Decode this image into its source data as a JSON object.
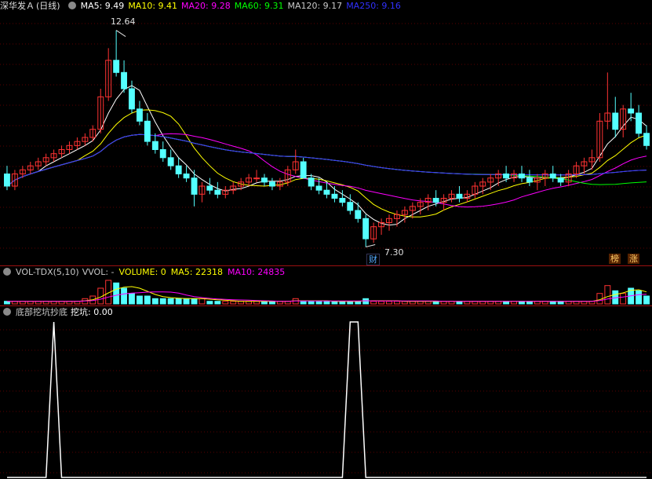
{
  "main": {
    "stock_name": "深华发Ａ",
    "period": "(日线)",
    "ma": [
      {
        "label": "MA5:",
        "value": "9.49",
        "color": "#ffffff"
      },
      {
        "label": "MA10:",
        "value": "9.41",
        "color": "#ffff00"
      },
      {
        "label": "MA20:",
        "value": "9.28",
        "color": "#ff00ff"
      },
      {
        "label": "MA60:",
        "value": "9.31",
        "color": "#00ff00"
      },
      {
        "label": "MA120:",
        "value": "9.17",
        "color": "#c8c8c8"
      },
      {
        "label": "MA250:",
        "value": "9.16",
        "color": "#3030ff"
      }
    ],
    "high_label": "12.64",
    "low_label": "7.30",
    "badge_cai": "财",
    "badge_bang": "榜",
    "badge_zhang": "涨"
  },
  "volume": {
    "name": "VOL-TDX(5,10)",
    "vvol": "VVOL: -",
    "volume": "VOLUME: 0",
    "ma5": "MA5: 22318",
    "ma10": "MA10: 24835"
  },
  "indicator": {
    "name": "底部挖坑抄底",
    "series_label": "挖坑: 0.00"
  },
  "colors": {
    "up": "#ff3232",
    "down": "#54ffff",
    "bg": "#000000",
    "separator": "#9a1010"
  },
  "chart_data": [
    {
      "type": "candlestick",
      "title": "深华发Ａ (日线)",
      "ylim": [
        7.0,
        13.0
      ],
      "annotations": [
        {
          "label": "12.64",
          "kind": "high"
        },
        {
          "label": "7.30",
          "kind": "low"
        }
      ],
      "ohlc": [
        [
          9.1,
          9.3,
          8.7,
          8.8
        ],
        [
          8.8,
          9.2,
          8.7,
          9.1
        ],
        [
          9.1,
          9.3,
          9.0,
          9.2
        ],
        [
          9.2,
          9.4,
          9.1,
          9.3
        ],
        [
          9.3,
          9.5,
          9.2,
          9.4
        ],
        [
          9.4,
          9.6,
          9.3,
          9.5
        ],
        [
          9.5,
          9.7,
          9.4,
          9.6
        ],
        [
          9.6,
          9.8,
          9.5,
          9.7
        ],
        [
          9.7,
          9.9,
          9.6,
          9.8
        ],
        [
          9.8,
          10.0,
          9.7,
          9.9
        ],
        [
          9.9,
          10.1,
          9.8,
          10.0
        ],
        [
          10.0,
          10.3,
          9.9,
          10.2
        ],
        [
          10.2,
          11.2,
          10.1,
          11.0
        ],
        [
          11.0,
          12.2,
          10.9,
          11.9
        ],
        [
          11.9,
          12.64,
          11.5,
          11.6
        ],
        [
          11.6,
          11.9,
          11.1,
          11.2
        ],
        [
          11.2,
          11.4,
          10.6,
          10.7
        ],
        [
          10.7,
          10.9,
          10.3,
          10.4
        ],
        [
          10.4,
          10.6,
          9.8,
          9.9
        ],
        [
          9.9,
          10.1,
          9.6,
          9.7
        ],
        [
          9.7,
          9.9,
          9.4,
          9.5
        ],
        [
          9.5,
          9.7,
          9.2,
          9.3
        ],
        [
          9.3,
          9.5,
          9.0,
          9.1
        ],
        [
          9.1,
          9.3,
          8.9,
          9.0
        ],
        [
          9.0,
          9.2,
          8.3,
          8.6
        ],
        [
          8.6,
          8.9,
          8.4,
          8.8
        ],
        [
          8.8,
          9.0,
          8.6,
          8.7
        ],
        [
          8.7,
          8.9,
          8.5,
          8.6
        ],
        [
          8.6,
          8.8,
          8.5,
          8.7
        ],
        [
          8.7,
          8.9,
          8.6,
          8.8
        ],
        [
          8.8,
          9.0,
          8.7,
          8.9
        ],
        [
          8.9,
          9.1,
          8.8,
          9.0
        ],
        [
          9.0,
          9.2,
          8.9,
          9.0
        ],
        [
          9.0,
          9.1,
          8.8,
          8.9
        ],
        [
          8.9,
          9.0,
          8.7,
          8.8
        ],
        [
          8.8,
          9.0,
          8.7,
          8.9
        ],
        [
          8.9,
          9.3,
          8.8,
          9.2
        ],
        [
          9.2,
          9.7,
          9.1,
          9.4
        ],
        [
          9.4,
          9.5,
          9.0,
          9.0
        ],
        [
          9.0,
          9.1,
          8.7,
          8.8
        ],
        [
          8.8,
          9.0,
          8.6,
          8.7
        ],
        [
          8.7,
          8.9,
          8.5,
          8.6
        ],
        [
          8.6,
          8.8,
          8.4,
          8.5
        ],
        [
          8.5,
          8.7,
          8.3,
          8.4
        ],
        [
          8.4,
          8.6,
          8.1,
          8.2
        ],
        [
          8.2,
          8.4,
          7.9,
          8.0
        ],
        [
          8.0,
          8.1,
          7.3,
          7.5
        ],
        [
          7.5,
          7.9,
          7.4,
          7.8
        ],
        [
          7.8,
          8.0,
          7.6,
          7.9
        ],
        [
          7.9,
          8.1,
          7.7,
          8.0
        ],
        [
          8.0,
          8.2,
          7.8,
          8.1
        ],
        [
          8.1,
          8.3,
          7.9,
          8.2
        ],
        [
          8.2,
          8.4,
          8.0,
          8.3
        ],
        [
          8.3,
          8.5,
          8.1,
          8.4
        ],
        [
          8.4,
          8.6,
          8.2,
          8.5
        ],
        [
          8.5,
          8.7,
          8.3,
          8.4
        ],
        [
          8.4,
          8.6,
          8.2,
          8.5
        ],
        [
          8.5,
          8.7,
          8.4,
          8.6
        ],
        [
          8.6,
          8.8,
          8.4,
          8.5
        ],
        [
          8.5,
          8.7,
          8.4,
          8.6
        ],
        [
          8.6,
          8.9,
          8.5,
          8.8
        ],
        [
          8.8,
          9.0,
          8.6,
          8.9
        ],
        [
          8.9,
          9.1,
          8.7,
          9.0
        ],
        [
          9.0,
          9.2,
          8.8,
          9.1
        ],
        [
          9.1,
          9.3,
          8.9,
          9.0
        ],
        [
          9.0,
          9.2,
          8.9,
          9.1
        ],
        [
          9.1,
          9.3,
          8.9,
          9.0
        ],
        [
          9.0,
          9.2,
          8.8,
          8.9
        ],
        [
          8.9,
          9.1,
          8.7,
          9.0
        ],
        [
          9.0,
          9.2,
          8.8,
          9.1
        ],
        [
          9.1,
          9.3,
          8.9,
          9.0
        ],
        [
          9.0,
          9.1,
          8.8,
          8.9
        ],
        [
          8.9,
          9.2,
          8.8,
          9.1
        ],
        [
          9.1,
          9.4,
          9.0,
          9.3
        ],
        [
          9.3,
          9.5,
          9.1,
          9.4
        ],
        [
          9.4,
          9.7,
          9.2,
          9.5
        ],
        [
          9.5,
          10.6,
          9.4,
          10.4
        ],
        [
          10.4,
          11.6,
          10.2,
          10.6
        ],
        [
          10.6,
          11.0,
          10.0,
          10.2
        ],
        [
          10.2,
          10.8,
          10.0,
          10.7
        ],
        [
          10.7,
          11.1,
          10.4,
          10.6
        ],
        [
          10.6,
          10.8,
          10.0,
          10.1
        ],
        [
          10.1,
          10.3,
          9.7,
          9.8
        ]
      ],
      "ma_series": [
        {
          "name": "MA5",
          "color": "#ffffff"
        },
        {
          "name": "MA10",
          "color": "#ffff00"
        },
        {
          "name": "MA20",
          "color": "#ff00ff"
        },
        {
          "name": "MA60",
          "color": "#00ff00"
        },
        {
          "name": "MA120",
          "color": "#c8c8c8"
        },
        {
          "name": "MA250",
          "color": "#3030ff"
        }
      ]
    },
    {
      "type": "bar",
      "title": "VOL-TDX(5,10)",
      "series": [
        {
          "name": "VOLUME",
          "values": [
            1,
            1,
            1,
            1,
            1,
            1,
            1,
            1,
            1,
            1,
            2,
            3,
            6,
            9,
            8,
            6,
            4,
            3,
            3,
            2,
            2,
            2,
            2,
            2,
            2,
            2,
            1,
            1,
            1,
            1,
            1,
            1,
            1,
            1,
            1,
            1,
            1,
            2,
            1,
            1,
            1,
            1,
            1,
            1,
            1,
            1,
            2,
            1,
            1,
            1,
            1,
            1,
            1,
            1,
            1,
            1,
            1,
            1,
            1,
            1,
            1,
            1,
            1,
            1,
            1,
            1,
            1,
            1,
            1,
            1,
            1,
            1,
            1,
            1,
            1,
            1,
            4,
            7,
            5,
            4,
            6,
            5,
            3
          ]
        }
      ]
    },
    {
      "type": "line",
      "title": "底部挖坑抄底",
      "series": [
        {
          "name": "挖坑",
          "values": [
            0,
            0,
            0,
            0,
            0,
            0,
            1,
            0,
            0,
            0,
            0,
            0,
            0,
            0,
            0,
            0,
            0,
            0,
            0,
            0,
            0,
            0,
            0,
            0,
            0,
            0,
            0,
            0,
            0,
            0,
            0,
            0,
            0,
            0,
            0,
            0,
            0,
            0,
            0,
            0,
            0,
            0,
            0,
            0,
            1,
            1,
            0,
            0,
            0,
            0,
            0,
            0,
            0,
            0,
            0,
            0,
            0,
            0,
            0,
            0,
            0,
            0,
            0,
            0,
            0,
            0,
            0,
            0,
            0,
            0,
            0,
            0,
            0,
            0,
            0,
            0,
            0,
            0,
            0,
            0,
            0,
            0,
            0
          ]
        }
      ],
      "ylim": [
        0,
        1
      ]
    }
  ]
}
